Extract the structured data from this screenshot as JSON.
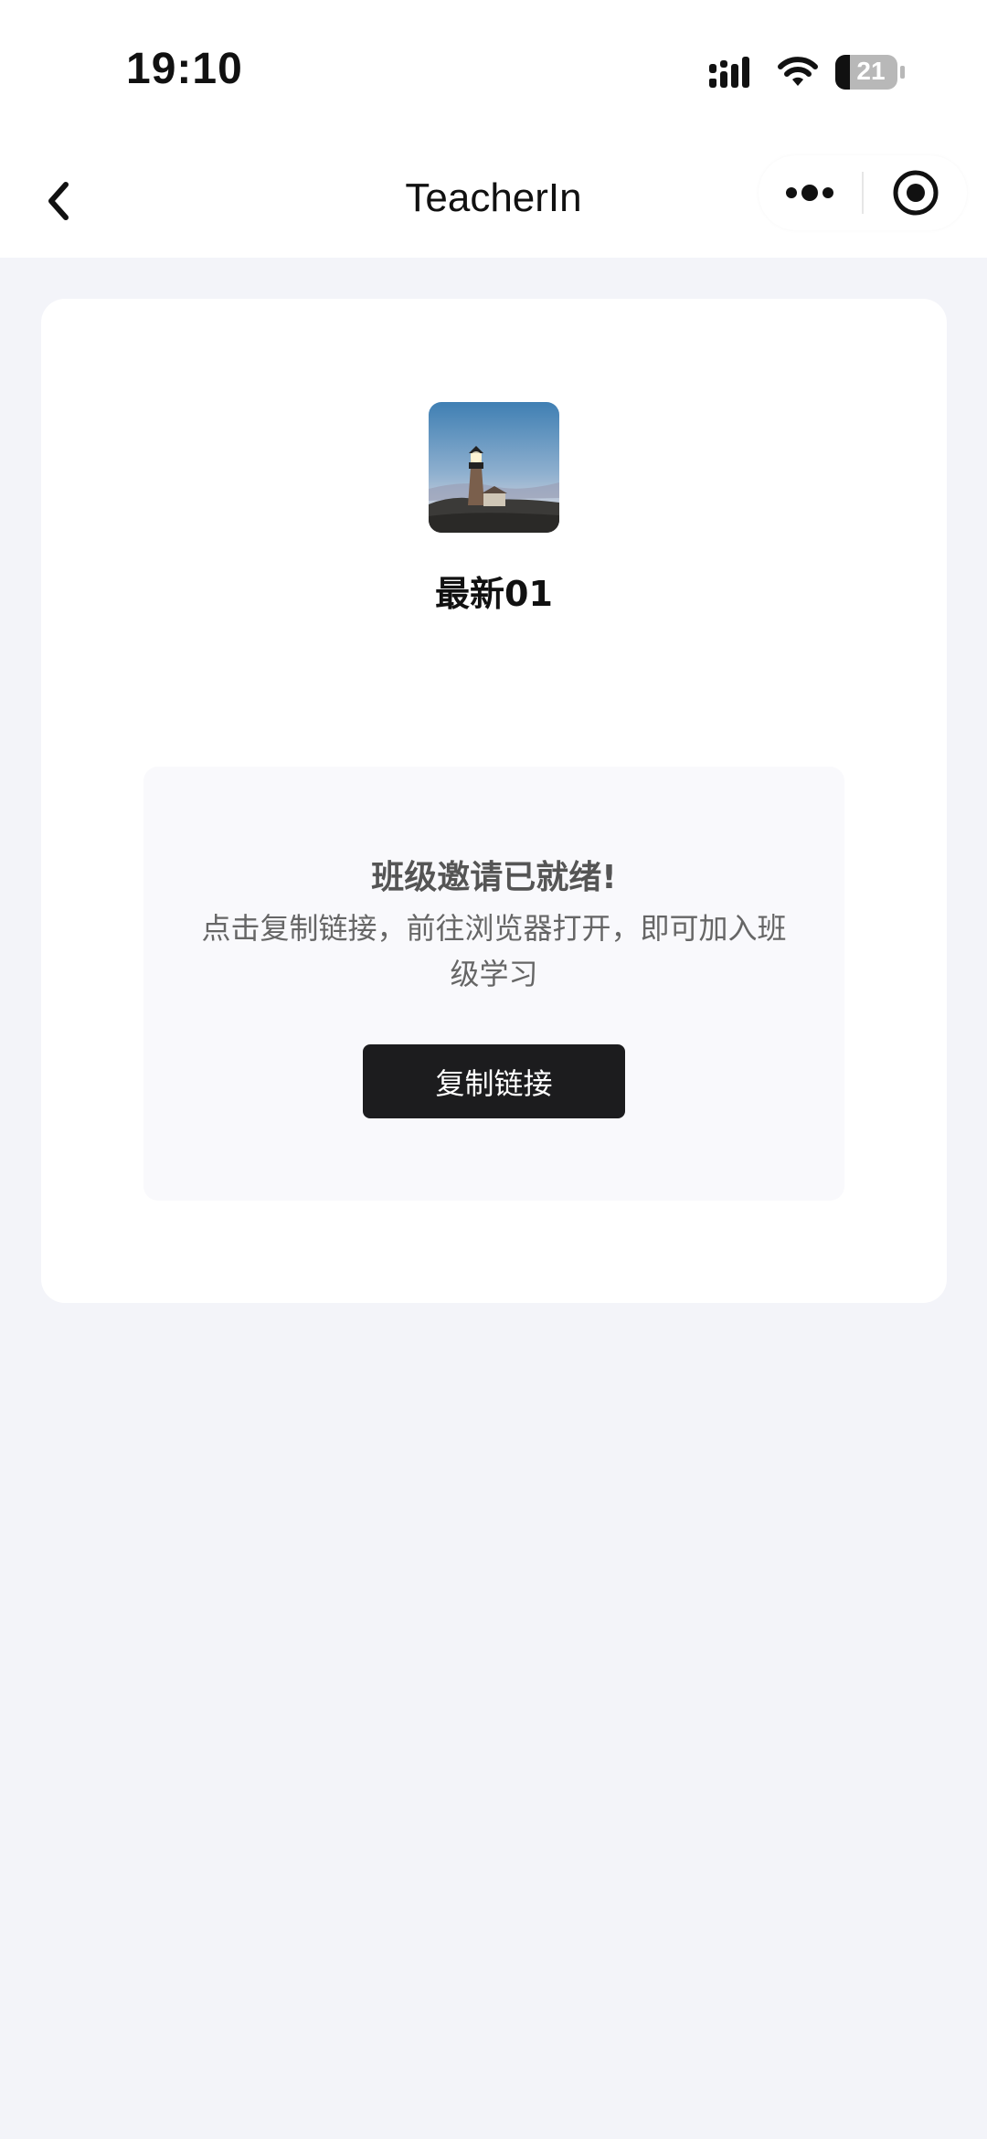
{
  "status_bar": {
    "time": "19:10",
    "battery": "21",
    "icons": [
      "signal-icon",
      "wifi-icon",
      "battery-icon"
    ]
  },
  "nav": {
    "title": "TeacherIn",
    "back_icon": "chevron-left-icon",
    "more_icon": "more-dots-icon",
    "close_icon": "target-circle-icon"
  },
  "class_card": {
    "avatar": "lighthouse-image",
    "name": "最新01"
  },
  "invite": {
    "title": "班级邀请已就绪!",
    "description": "点击复制链接，前往浏览器打开，即可加入班级学习",
    "button_label": "复制链接"
  },
  "colors": {
    "page_background": "#f3f4f9",
    "card_background": "#ffffff",
    "invite_box_background": "#f9f9fc",
    "button_background": "#1c1c1e",
    "button_text": "#ffffff"
  }
}
